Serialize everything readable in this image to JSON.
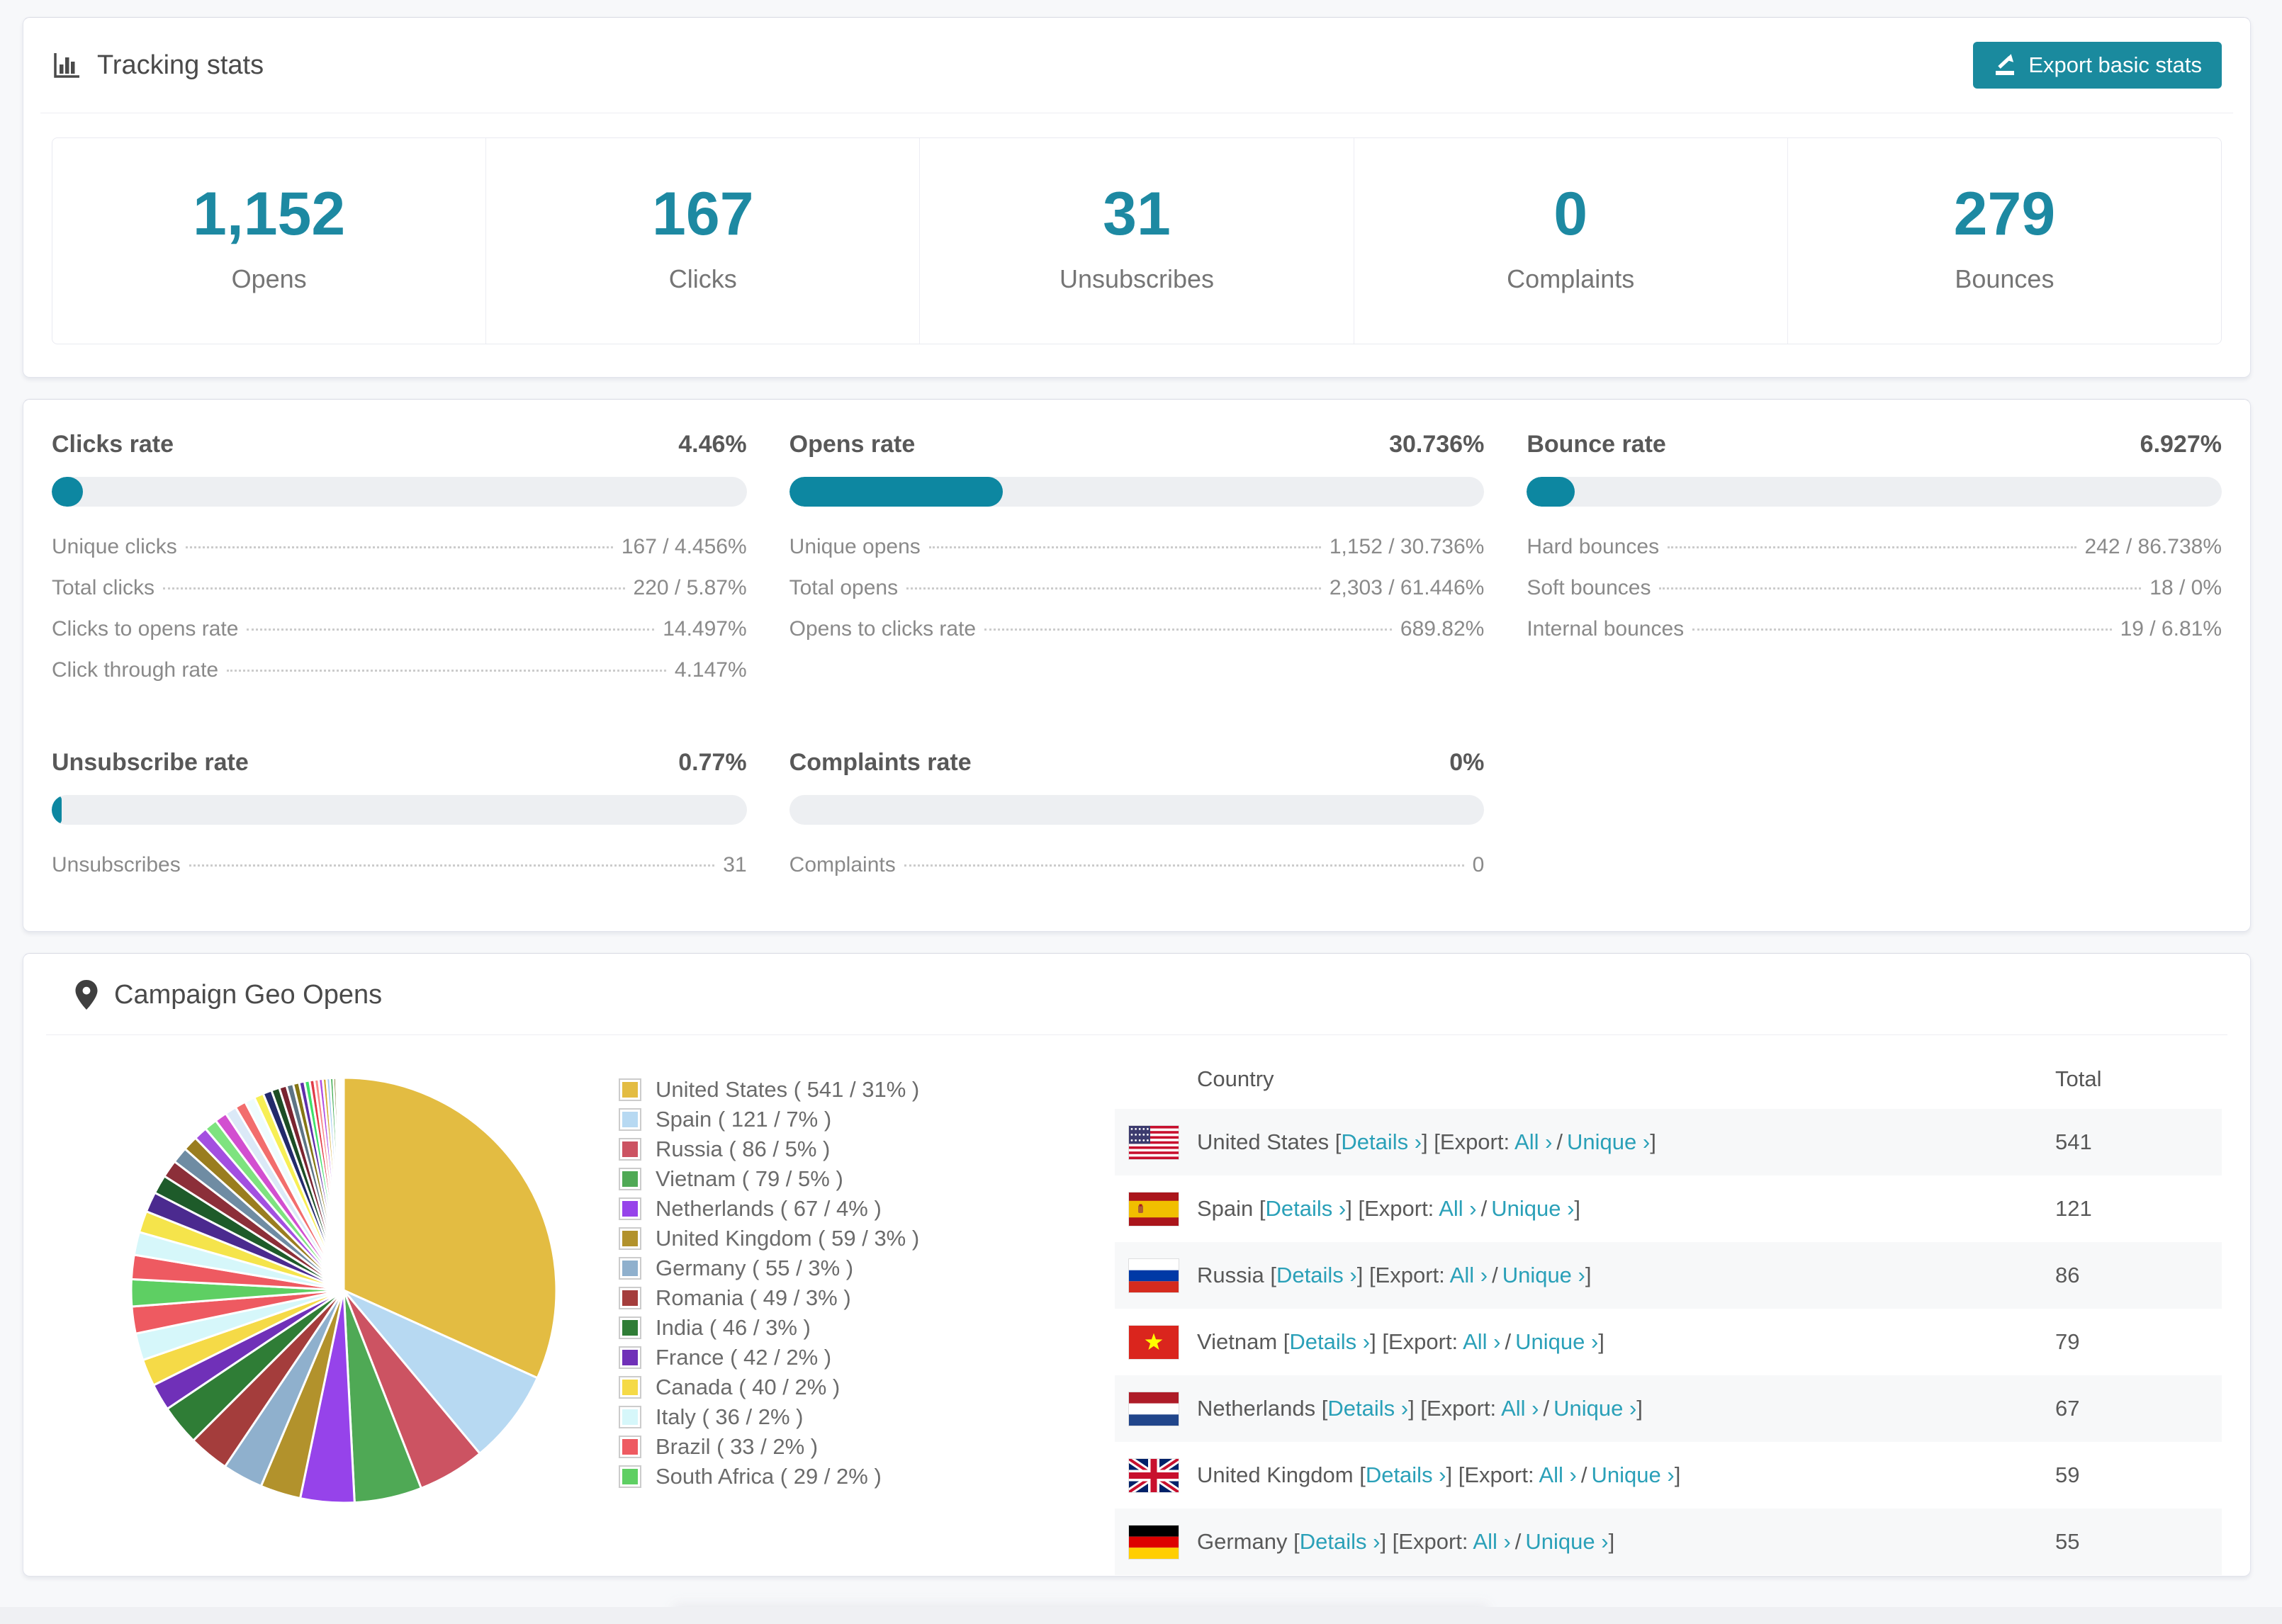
{
  "accent": {
    "teal": "#1d89a2",
    "link": "#2aa0b8",
    "progress_fill": "#0d87a1",
    "button": "#1a8a9e"
  },
  "icons": {
    "header": "bar-chart-icon",
    "export": "export-icon",
    "geo": "map-pin-icon"
  },
  "tracking": {
    "title": "Tracking stats",
    "export_button": "Export basic stats",
    "stats": [
      {
        "value": "1,152",
        "label": "Opens"
      },
      {
        "value": "167",
        "label": "Clicks"
      },
      {
        "value": "31",
        "label": "Unsubscribes"
      },
      {
        "value": "0",
        "label": "Complaints"
      },
      {
        "value": "279",
        "label": "Bounces"
      }
    ]
  },
  "rates": {
    "clicks": {
      "title": "Clicks rate",
      "value": "4.46%",
      "pct": 4.46,
      "rows": [
        {
          "label": "Unique clicks",
          "value": "167 / 4.456%"
        },
        {
          "label": "Total clicks",
          "value": "220 / 5.87%"
        },
        {
          "label": "Clicks to opens rate",
          "value": "14.497%"
        },
        {
          "label": "Click through rate",
          "value": "4.147%"
        }
      ]
    },
    "opens": {
      "title": "Opens rate",
      "value": "30.736%",
      "pct": 30.736,
      "rows": [
        {
          "label": "Unique opens",
          "value": "1,152 / 30.736%"
        },
        {
          "label": "Total opens",
          "value": "2,303 / 61.446%"
        },
        {
          "label": "Opens to clicks rate",
          "value": "689.82%"
        }
      ]
    },
    "bounce": {
      "title": "Bounce rate",
      "value": "6.927%",
      "pct": 6.927,
      "rows": [
        {
          "label": "Hard bounces",
          "value": "242 / 86.738%"
        },
        {
          "label": "Soft bounces",
          "value": "18 / 0%"
        },
        {
          "label": "Internal bounces",
          "value": "19 / 6.81%"
        }
      ]
    },
    "unsubscribe": {
      "title": "Unsubscribe rate",
      "value": "0.77%",
      "pct": 0.77,
      "rows": [
        {
          "label": "Unsubscribes",
          "value": "31"
        }
      ]
    },
    "complaints": {
      "title": "Complaints rate",
      "value": "0%",
      "pct": 0,
      "rows": [
        {
          "label": "Complaints",
          "value": "0"
        }
      ]
    }
  },
  "geo": {
    "title": "Campaign Geo Opens",
    "table": {
      "headers": {
        "country": "Country",
        "total": "Total"
      },
      "link_parts": {
        "bracket_open": "[",
        "details": "Details ›",
        "bracket_close": "]",
        "export_open": "[Export:",
        "all": "All ›",
        "slash": "/",
        "unique": "Unique ›",
        "export_close": "]"
      },
      "rows": [
        {
          "name": "United States",
          "flag": "us",
          "total": "541"
        },
        {
          "name": "Spain",
          "flag": "es",
          "total": "121"
        },
        {
          "name": "Russia",
          "flag": "ru",
          "total": "86"
        },
        {
          "name": "Vietnam",
          "flag": "vn",
          "total": "79"
        },
        {
          "name": "Netherlands",
          "flag": "nl",
          "total": "67"
        },
        {
          "name": "United Kingdom",
          "flag": "gb",
          "total": "59"
        },
        {
          "name": "Germany",
          "flag": "de",
          "total": "55"
        }
      ]
    }
  },
  "chart_data": {
    "type": "pie",
    "title": "Campaign Geo Opens",
    "legend_position": "right",
    "start_angle_deg": 0,
    "direction": "clockwise",
    "slices": [
      {
        "label": "United States",
        "count": 541,
        "pct": 31,
        "color": "#e3bc42",
        "legend": "United States ( 541 / 31% )"
      },
      {
        "label": "Spain",
        "count": 121,
        "pct": 7,
        "color": "#b7d9f2",
        "legend": "Spain ( 121 / 7% )"
      },
      {
        "label": "Russia",
        "count": 86,
        "pct": 5,
        "color": "#cc5362",
        "legend": "Russia ( 86 / 5% )"
      },
      {
        "label": "Vietnam",
        "count": 79,
        "pct": 5,
        "color": "#4fa955",
        "legend": "Vietnam ( 79 / 5% )"
      },
      {
        "label": "Netherlands",
        "count": 67,
        "pct": 4,
        "color": "#9643ea",
        "legend": "Netherlands ( 67 / 4% )"
      },
      {
        "label": "United Kingdom",
        "count": 59,
        "pct": 3,
        "color": "#b2922c",
        "legend": "United Kingdom ( 59 / 3% )"
      },
      {
        "label": "Germany",
        "count": 55,
        "pct": 3,
        "color": "#8fb0cd",
        "legend": "Germany ( 55 / 3% )"
      },
      {
        "label": "Romania",
        "count": 49,
        "pct": 3,
        "color": "#a43d3c",
        "legend": "Romania ( 49 / 3% )"
      },
      {
        "label": "India",
        "count": 46,
        "pct": 3,
        "color": "#2f7d36",
        "legend": "India ( 46 / 3% )"
      },
      {
        "label": "France",
        "count": 42,
        "pct": 2,
        "color": "#7030b8",
        "legend": "France ( 42 / 2% )"
      },
      {
        "label": "Canada",
        "count": 40,
        "pct": 2,
        "color": "#f5da47",
        "legend": "Canada ( 40 / 2% )"
      },
      {
        "label": "Italy",
        "count": 36,
        "pct": 2,
        "color": "#d6f7fa",
        "legend": "Italy ( 36 / 2% )"
      },
      {
        "label": "Brazil",
        "count": 33,
        "pct": 2,
        "color": "#ee5a61",
        "legend": "Brazil ( 33 / 2% )"
      },
      {
        "label": "South Africa",
        "count": 29,
        "pct": 2,
        "color": "#5ecf63",
        "legend": "South Africa ( 29 / 2% )"
      }
    ],
    "other_slices": {
      "pcts": [
        1.8,
        1.7,
        1.6,
        1.5,
        1.4,
        1.3,
        1.2,
        1.1,
        1.0,
        0.95,
        0.9,
        0.85,
        0.8,
        0.75,
        0.7,
        0.65,
        0.6,
        0.55,
        0.5,
        0.45,
        0.4,
        0.38,
        0.35,
        0.32,
        0.3,
        0.28,
        0.26,
        0.24,
        0.2,
        0.15,
        0.12,
        0.1,
        0.08,
        0.06,
        0.05
      ],
      "colors": [
        "#ee5a61",
        "#d6f7fa",
        "#f5e44b",
        "#4b2a8f",
        "#1e5b2a",
        "#8c2f39",
        "#6f8ca3",
        "#9a7d1f",
        "#a34fe0",
        "#7ee37f",
        "#d24fd0",
        "#dbe9f7",
        "#f26d6d",
        "#eefcfd",
        "#f7ef55",
        "#232a6b",
        "#1d4d25",
        "#7a2430",
        "#5d7485",
        "#857614",
        "#5e2fa8",
        "#3ee06a",
        "#e03b47",
        "#f98b8b",
        "#b14fe0",
        "#d4a92f",
        "#9cc6ee",
        "#37a84a",
        "#6b6410",
        "#7b3fd4",
        "#d84752",
        "#4f7dd9",
        "#8a5fe8",
        "#44c05a",
        "#999fb0"
      ]
    }
  }
}
